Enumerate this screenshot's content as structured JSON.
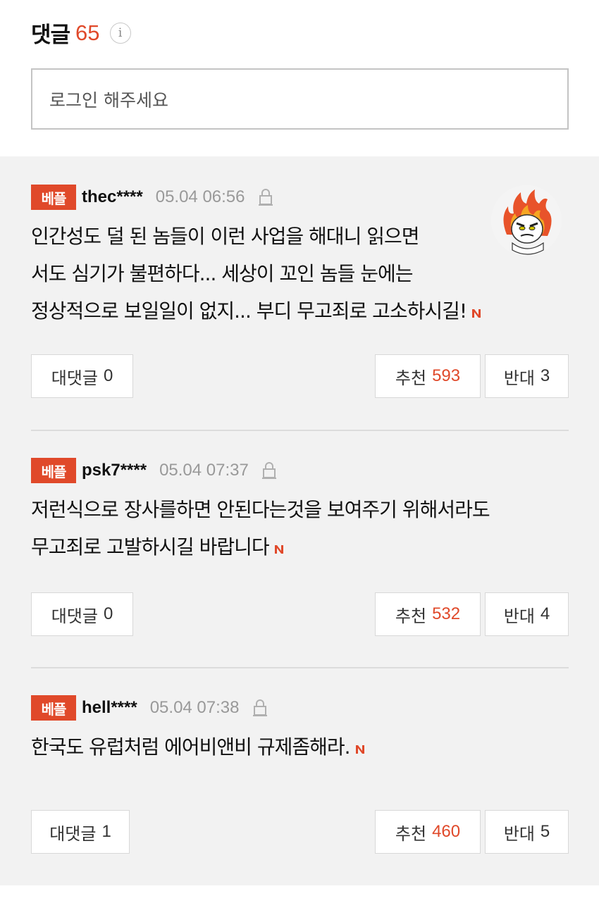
{
  "header": {
    "title": "댓글",
    "count": "65",
    "info_icon": "i"
  },
  "login": {
    "placeholder": "로그인 해주세요"
  },
  "comments": [
    {
      "badge": "베플",
      "user": "thec****",
      "date": "05.04 06:56",
      "lines": [
        "인간성도 덜 된 놈들이 이런 사업을 해대니 읽으면",
        "서도 심기가 불편하다... 세상이 꼬인 놈들 눈에는",
        "정상적으로 보일일이 없지... 부디 무고죄로 고소하시길!"
      ],
      "reply_label": "대댓글",
      "reply_count": "0",
      "up_label": "추천",
      "up_count": "593",
      "down_label": "반대",
      "down_count": "3"
    },
    {
      "badge": "베플",
      "user": "psk7****",
      "date": "05.04 07:37",
      "lines": [
        "저런식으로 장사를하면 안된다는것을 보여주기 위해서라도",
        "무고죄로 고발하시길 바랍니다"
      ],
      "reply_label": "대댓글",
      "reply_count": "0",
      "up_label": "추천",
      "up_count": "532",
      "down_label": "반대",
      "down_count": "4"
    },
    {
      "badge": "베플",
      "user": "hell****",
      "date": "05.04 07:38",
      "lines": [
        "한국도 유럽처럼 에어비앤비 규제좀해라."
      ],
      "reply_label": "대댓글",
      "reply_count": "1",
      "up_label": "추천",
      "up_count": "460",
      "down_label": "반대",
      "down_count": "5"
    }
  ],
  "colors": {
    "accent": "#e0492a",
    "background": "#f2f2f2"
  },
  "icons": [
    "info-icon",
    "lock-icon",
    "n-mark-icon",
    "avatar-flame-face"
  ]
}
